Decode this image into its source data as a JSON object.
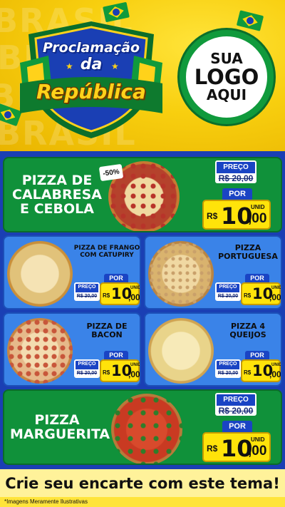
{
  "header": {
    "bg_word": "BRASIL",
    "title_line1": "Proclamação",
    "title_line2": "da",
    "title_line3": "República",
    "logo_line1": "SUA",
    "logo_line2": "LOGO",
    "logo_line3": "AQUI"
  },
  "products": {
    "calabresa": {
      "name_line1": "PIZZA DE",
      "name_line2": "CALABRESA",
      "name_line3": "E CEBOLA",
      "discount": "-50%",
      "old_label": "PREÇO",
      "old_price": "R$ 20,00",
      "por_label": "POR",
      "currency": "R$",
      "price_int": "10",
      "price_dec": ",00",
      "unit": "UNID"
    },
    "frango": {
      "name_line1": "PIZZA DE FRANGO",
      "name_line2": "COM CATUPIRY",
      "old_label": "PREÇO",
      "old_price": "R$ 20,00",
      "por_label": "POR",
      "currency": "R$",
      "price_int": "10",
      "price_dec": ",00",
      "unit": "UNID"
    },
    "portuguesa": {
      "name_line1": "PIZZA",
      "name_line2": "PORTUGUESA",
      "old_label": "PREÇO",
      "old_price": "R$ 20,00",
      "por_label": "POR",
      "currency": "R$",
      "price_int": "10",
      "price_dec": ",00",
      "unit": "UNID"
    },
    "bacon": {
      "name_line1": "PIZZA DE",
      "name_line2": "BACON",
      "old_label": "PREÇO",
      "old_price": "R$ 20,00",
      "por_label": "POR",
      "currency": "R$",
      "price_int": "10",
      "price_dec": ",00",
      "unit": "UNID"
    },
    "queijos": {
      "name_line1": "PIZZA 4",
      "name_line2": "QUEIJOS",
      "old_label": "PREÇO",
      "old_price": "R$ 20,00",
      "por_label": "POR",
      "currency": "R$",
      "price_int": "10",
      "price_dec": ",00",
      "unit": "UNID"
    },
    "marguerita": {
      "name_line1": "PIZZA",
      "name_line2": "MARGUERITA",
      "old_label": "PREÇO",
      "old_price": "R$ 20,00",
      "por_label": "POR",
      "currency": "R$",
      "price_int": "10",
      "price_dec": ",00",
      "unit": "UNID"
    }
  },
  "footer": {
    "cta": "Crie seu encarte com este tema!",
    "disclaimer": "*Imagens Meramente Ilustrativas"
  },
  "colors": {
    "brand_green": "#10913a",
    "brand_blue": "#1a3fb4",
    "brand_yellow": "#ffe30a"
  }
}
